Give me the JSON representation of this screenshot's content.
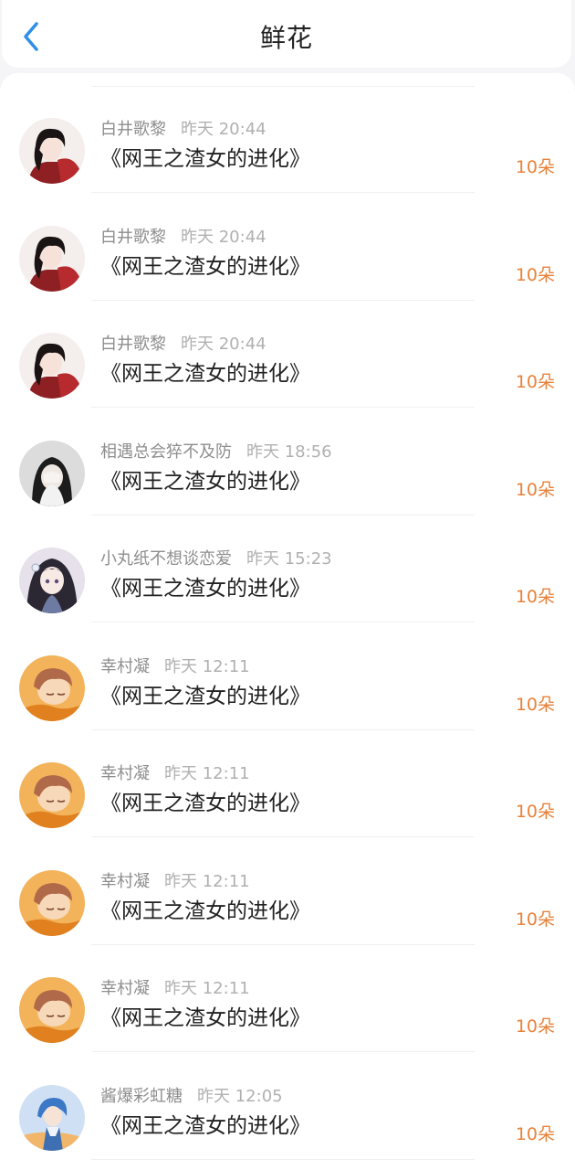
{
  "header": {
    "back_icon": "chevron-left-icon",
    "title": "鲜花"
  },
  "colors": {
    "back_icon": "#2f8ee8",
    "amount": "#e8823a",
    "name": "#8e8e8e",
    "time": "#b0b0b0",
    "title": "#222222"
  },
  "list": [
    {
      "avatar": "avatar-dark-hair-red-robe",
      "name": "白井歌黎",
      "time": "昨天 20:44",
      "book": "《网王之渣女的进化》",
      "amount": "10朵"
    },
    {
      "avatar": "avatar-dark-hair-red-robe",
      "name": "白井歌黎",
      "time": "昨天 20:44",
      "book": "《网王之渣女的进化》",
      "amount": "10朵"
    },
    {
      "avatar": "avatar-dark-hair-red-robe",
      "name": "白井歌黎",
      "time": "昨天 20:44",
      "book": "《网王之渣女的进化》",
      "amount": "10朵"
    },
    {
      "avatar": "avatar-girl-covering-face",
      "name": "相遇总会猝不及防",
      "time": "昨天 18:56",
      "book": "《网王之渣女的进化》",
      "amount": "10朵"
    },
    {
      "avatar": "avatar-anime-girl-dark-hair",
      "name": "小丸纸不想谈恋爱",
      "time": "昨天 15:23",
      "book": "《网王之渣女的进化》",
      "amount": "10朵"
    },
    {
      "avatar": "avatar-anime-boy-sleeping",
      "name": "幸村凝",
      "time": "昨天 12:11",
      "book": "《网王之渣女的进化》",
      "amount": "10朵"
    },
    {
      "avatar": "avatar-anime-boy-sleeping",
      "name": "幸村凝",
      "time": "昨天 12:11",
      "book": "《网王之渣女的进化》",
      "amount": "10朵"
    },
    {
      "avatar": "avatar-anime-boy-sleeping",
      "name": "幸村凝",
      "time": "昨天 12:11",
      "book": "《网王之渣女的进化》",
      "amount": "10朵"
    },
    {
      "avatar": "avatar-anime-boy-sleeping",
      "name": "幸村凝",
      "time": "昨天 12:11",
      "book": "《网王之渣女的进化》",
      "amount": "10朵"
    },
    {
      "avatar": "avatar-blue-hair-character",
      "name": "酱爆彩虹糖",
      "time": "昨天 12:05",
      "book": "《网王之渣女的进化》",
      "amount": "10朵"
    }
  ]
}
